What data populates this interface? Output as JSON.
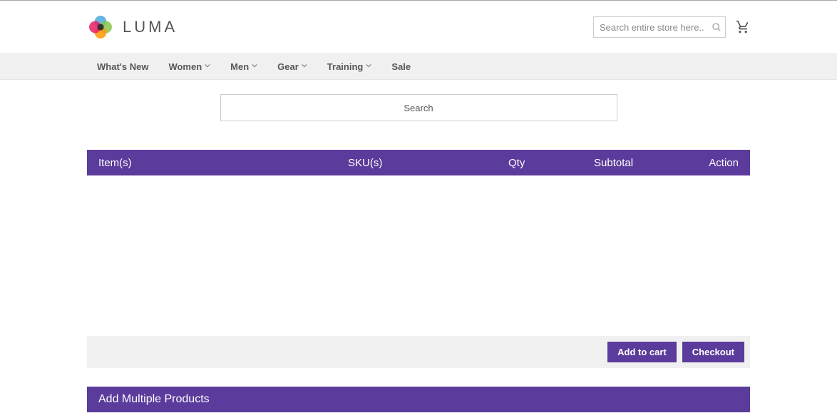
{
  "header": {
    "logo_text": "LUMA",
    "search_placeholder": "Search entire store here..."
  },
  "nav": {
    "items": [
      {
        "label": "What's New",
        "has_dropdown": false
      },
      {
        "label": "Women",
        "has_dropdown": true
      },
      {
        "label": "Men",
        "has_dropdown": true
      },
      {
        "label": "Gear",
        "has_dropdown": true
      },
      {
        "label": "Training",
        "has_dropdown": true
      },
      {
        "label": "Sale",
        "has_dropdown": false
      }
    ]
  },
  "center_search": {
    "placeholder": "Search"
  },
  "table": {
    "columns": {
      "items": "Item(s)",
      "sku": "SKU(s)",
      "qty": "Qty",
      "subtotal": "Subtotal",
      "action": "Action"
    },
    "rows": []
  },
  "actions": {
    "add_to_cart": "Add to cart",
    "checkout": "Checkout"
  },
  "section": {
    "add_multiple_products": "Add Multiple Products"
  }
}
